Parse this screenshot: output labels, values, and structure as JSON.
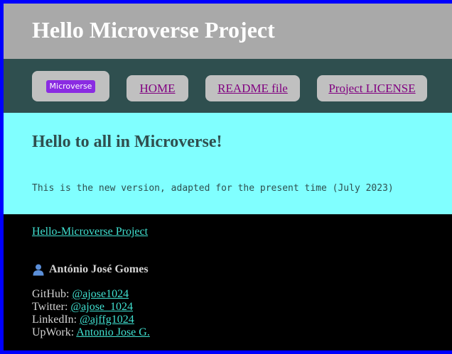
{
  "header": {
    "title": "Hello Microverse Project"
  },
  "nav": {
    "badge": "Microverse",
    "items": [
      {
        "label": "HOME"
      },
      {
        "label": "README file"
      },
      {
        "label": "Project LICENSE"
      }
    ]
  },
  "main": {
    "heading": "Hello to all in Microverse!",
    "text": "This is the new version, adapted for the present time (July 2023)"
  },
  "footer": {
    "project_link": "Hello-Microverse Project",
    "author": {
      "icon": "person-icon",
      "name": "António José Gomes"
    },
    "contacts": [
      {
        "label": "GitHub:",
        "link": "@ajose1024"
      },
      {
        "label": "Twitter:",
        "link": "@ajose_1024"
      },
      {
        "label": "LinkedIn:",
        "link": "@ajffg1024"
      },
      {
        "label": "UpWork:",
        "link": "Antonio Jose G."
      }
    ]
  },
  "colors": {
    "page_border": "#0000ff",
    "header_bg": "#a9a9a9",
    "nav_bg": "#2f4f4f",
    "nav_button_bg": "#c0c0c0",
    "badge_bg": "#8a2be2",
    "main_bg": "#80ffff",
    "footer_bg": "#000000",
    "link_color": "#40e0d0",
    "nav_link_color": "#800080"
  }
}
